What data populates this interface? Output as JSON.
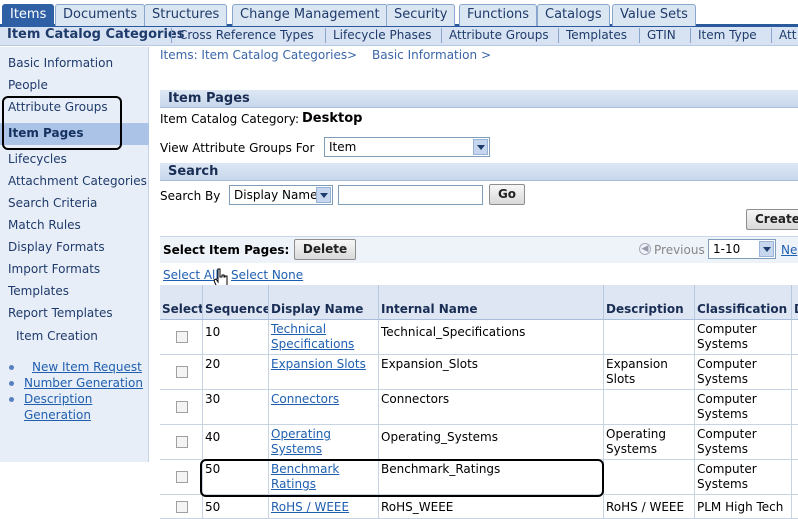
{
  "tabs": [
    "Items",
    "Documents",
    "Structures",
    "Change Management",
    "Security",
    "Functions",
    "Catalogs",
    "Value Sets"
  ],
  "subnav": [
    "Item Catalog Categories",
    "Cross Reference Types",
    "Lifecycle Phases",
    "Attribute Groups",
    "Templates",
    "GTIN",
    "Item Type",
    "Att"
  ],
  "breadcrumb": {
    "first": "Items: Item Catalog Categories",
    "sep1": ">",
    "second": "Basic Information",
    "sep2": ">"
  },
  "sidenav": {
    "items": [
      "Basic Information",
      "People",
      "Attribute Groups",
      "Item Pages",
      "Lifecycles",
      "Attachment Categories",
      "Search Criteria",
      "Match Rules",
      "Display Formats",
      "Import Formats",
      "Templates",
      "Report Templates"
    ],
    "item_creation": "Item Creation",
    "links": [
      "New Item Request",
      "Number Generation",
      "Description",
      "Generation"
    ]
  },
  "item_pages": {
    "header": "Item Pages",
    "category_label": "Item Catalog Category:",
    "category_value": "Desktop",
    "view_label": "View Attribute Groups For",
    "view_value": "Item"
  },
  "search": {
    "header": "Search",
    "by_label": "Search By",
    "by_value": "Display Name",
    "go": "Go",
    "create": "Create"
  },
  "select_bar": {
    "label": "Select Item Pages:",
    "delete": "Delete",
    "previous": "Previous",
    "range": "1-10",
    "next": "Ne",
    "select_all": "Select All",
    "select_none": "Select None"
  },
  "table": {
    "columns": [
      "Select",
      "Sequence",
      "Display Name",
      "Internal Name",
      "Description",
      "Classification",
      "D"
    ],
    "rows": [
      {
        "seq": "10",
        "name1": "Technical",
        "name2": "Specifications",
        "internal": "Technical_Specifications",
        "desc1": "",
        "desc2": "",
        "class1": "Computer",
        "class2": "Systems"
      },
      {
        "seq": "20",
        "name1": "Expansion Slots",
        "name2": "",
        "internal": "Expansion_Slots",
        "desc1": "Expansion Slots",
        "desc2": "",
        "class1": "Computer",
        "class2": "Systems"
      },
      {
        "seq": "30",
        "name1": "Connectors",
        "name2": "",
        "internal": "Connectors",
        "desc1": "",
        "desc2": "",
        "class1": "Computer",
        "class2": "Systems"
      },
      {
        "seq": "40",
        "name1": "Operating",
        "name2": "Systems",
        "internal": "Operating_Systems",
        "desc1": "Operating",
        "desc2": "Systems",
        "class1": "Computer",
        "class2": "Systems"
      },
      {
        "seq": "50",
        "name1": "Benchmark",
        "name2": "Ratings",
        "internal": "Benchmark_Ratings",
        "desc1": "",
        "desc2": "",
        "class1": "Computer",
        "class2": "Systems"
      },
      {
        "seq": "50",
        "name1": "RoHS / WEEE",
        "name2": "",
        "internal": "RoHS_WEEE",
        "desc1": "RoHS / WEEE",
        "desc2": "",
        "class1": "PLM High Tech",
        "class2": ""
      }
    ]
  }
}
